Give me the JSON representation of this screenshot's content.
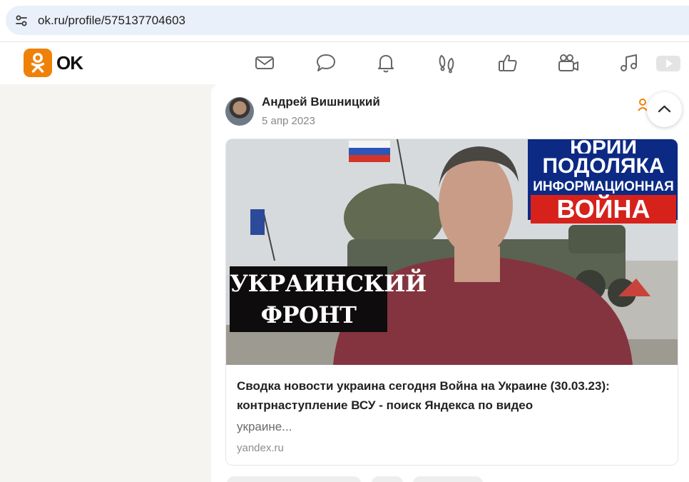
{
  "browser": {
    "url": "ok.ru/profile/575137704603",
    "site_icon": "tune-icon"
  },
  "header": {
    "logo_text": "OK",
    "brand_color": "#ee8208",
    "nav_icons": [
      "mail-icon",
      "chat-icon",
      "bell-icon",
      "guests-icon",
      "like-icon",
      "video-camera-icon",
      "music-icon",
      "video-play-icon"
    ]
  },
  "post": {
    "author": "Андрей Вишницкий",
    "date": "5 апр 2023",
    "preview": {
      "thumbnail_left_lines": [
        "УКРАИНСКИЙ",
        "ФРОНТ"
      ],
      "thumbnail_right_lines": [
        "ЮРИЙ",
        "ПОДОЛЯКА",
        "ИНФОРМАЦИОННАЯ",
        "ВОЙНА"
      ],
      "title": "Сводка новости украина сегодня Война на Украине (30.03.23): контрнаступление ВСУ - поиск Яндекса по видео",
      "description": "украине...",
      "domain": "yandex.ru"
    }
  }
}
